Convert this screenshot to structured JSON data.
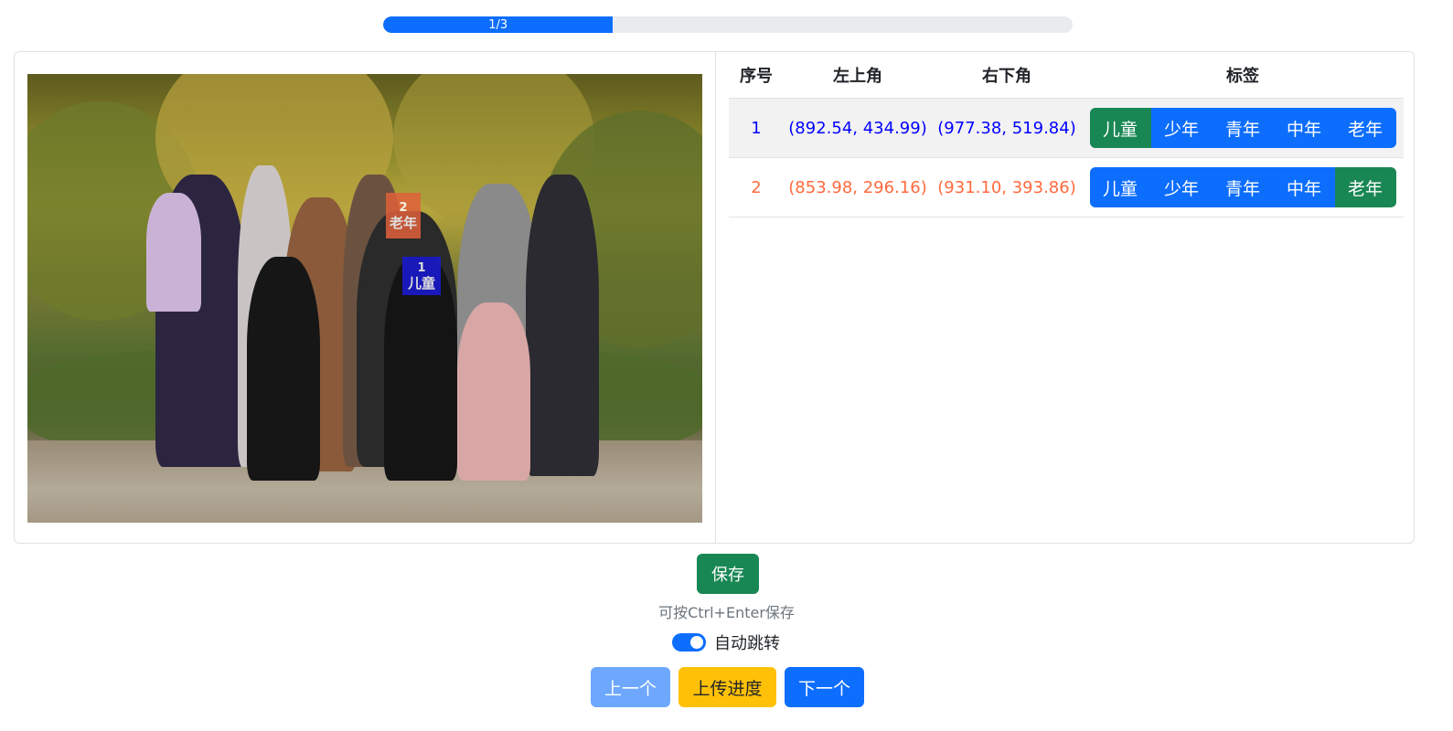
{
  "progress": {
    "label": "1/3",
    "fraction": 0.3333
  },
  "table": {
    "headers": [
      "序号",
      "左上角",
      "右下角",
      "标签"
    ],
    "tag_options": [
      "儿童",
      "少年",
      "青年",
      "中年",
      "老年"
    ],
    "rows": [
      {
        "index": "1",
        "top_left": "(892.54, 434.99)",
        "bottom_right": "(977.38, 519.84)",
        "selected": "儿童"
      },
      {
        "index": "2",
        "top_left": "(853.98, 296.16)",
        "bottom_right": "(931.10, 393.86)",
        "selected": "老年"
      }
    ]
  },
  "face_boxes": [
    {
      "num": "1",
      "label": "儿童",
      "color": "#1a1ad6"
    },
    {
      "num": "2",
      "label": "老年",
      "color": "#e0603a"
    }
  ],
  "actions": {
    "save_label": "保存",
    "hint": "可按Ctrl+Enter保存",
    "auto_jump_label": "自动跳转",
    "auto_jump_on": true,
    "prev_label": "上一个",
    "upload_label": "上传进度",
    "next_label": "下一个"
  },
  "colors": {
    "primary": "#0d6efd",
    "success": "#198754",
    "warning": "#ffc107",
    "primary_disabled": "#6ea8fe",
    "row1_text": "#0000ff",
    "row2_text": "#ff6a3d"
  }
}
